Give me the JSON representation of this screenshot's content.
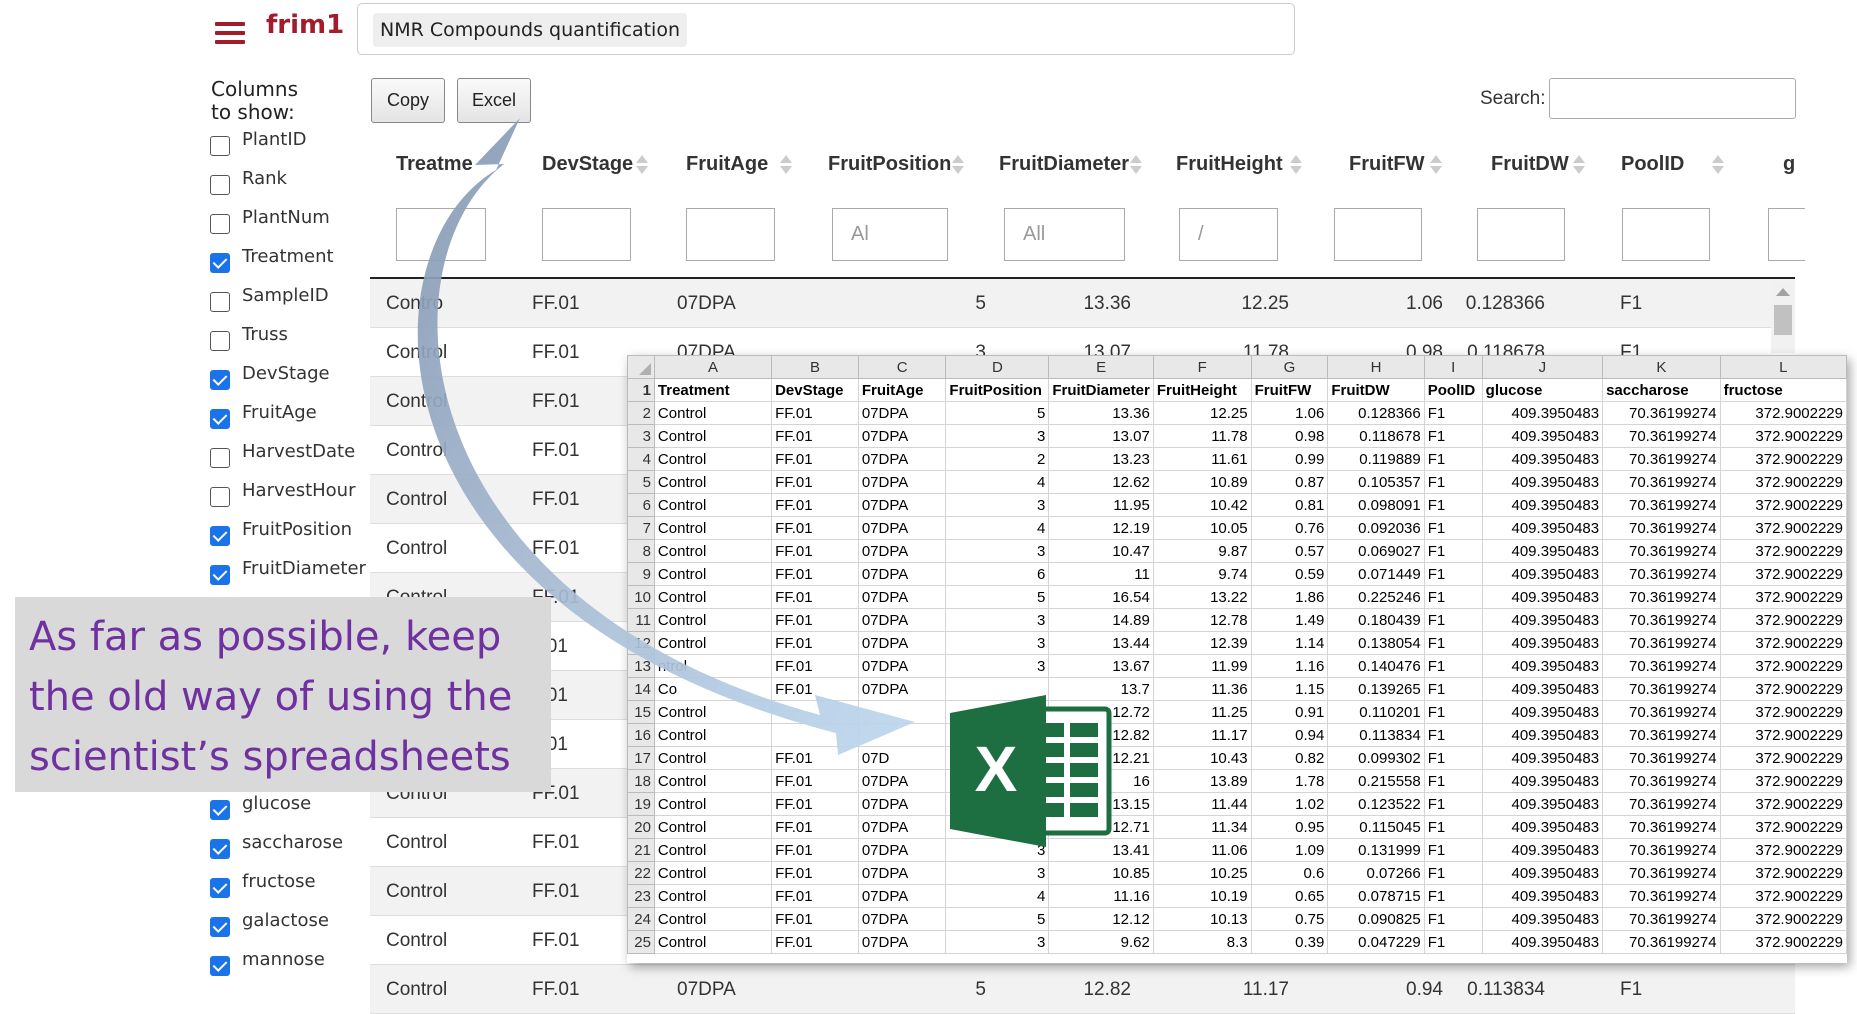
{
  "app": {
    "brand": "frim1",
    "title": "NMR Compounds quantification"
  },
  "sidebar": {
    "heading": "Columns to show:",
    "items": [
      {
        "label": "PlantID",
        "checked": false
      },
      {
        "label": "Rank",
        "checked": false
      },
      {
        "label": "PlantNum",
        "checked": false
      },
      {
        "label": "Treatment",
        "checked": true
      },
      {
        "label": "SampleID",
        "checked": false
      },
      {
        "label": "Truss",
        "checked": false
      },
      {
        "label": "DevStage",
        "checked": true
      },
      {
        "label": "FruitAge",
        "checked": true
      },
      {
        "label": "HarvestDate",
        "checked": false
      },
      {
        "label": "HarvestHour",
        "checked": false
      },
      {
        "label": "FruitPosition",
        "checked": true
      },
      {
        "label": "FruitDiameter",
        "checked": true
      },
      {
        "label": "glucose",
        "checked": true
      },
      {
        "label": "saccharose",
        "checked": true
      },
      {
        "label": "fructose",
        "checked": true
      },
      {
        "label": "galactose",
        "checked": true
      },
      {
        "label": "mannose",
        "checked": true
      }
    ]
  },
  "toolbar": {
    "copy_label": "Copy",
    "excel_label": "Excel",
    "search_label": "Search:",
    "search_value": ""
  },
  "table": {
    "headers": [
      "Treatme",
      "DevStage",
      "FruitAge",
      "FruitPosition",
      "FruitDiameter",
      "FruitHeight",
      "FruitFW",
      "FruitDW",
      "PoolID",
      "g"
    ],
    "filters": [
      "",
      "",
      "",
      "Al",
      "All",
      "/",
      "",
      "",
      "",
      ""
    ],
    "rows": [
      [
        "Contro",
        "FF.01",
        "07DPA",
        "5",
        "13.36",
        "12.25",
        "1.06",
        "0.128366",
        "F1"
      ],
      [
        "Control",
        "FF.01",
        "07DPA",
        "3",
        "13.07",
        "11.78",
        "0.98",
        "0.118678",
        "F1"
      ],
      [
        "Control",
        "FF.01",
        "",
        "",
        "",
        "",
        "",
        "",
        ""
      ],
      [
        "Control",
        "FF.01",
        "",
        "",
        "",
        "",
        "",
        "",
        ""
      ],
      [
        "Control",
        "FF.01",
        "",
        "",
        "",
        "",
        "",
        "",
        ""
      ],
      [
        "Control",
        "FF.01",
        "",
        "",
        "",
        "",
        "",
        "",
        ""
      ],
      [
        "Control",
        "FF.01",
        "",
        "",
        "",
        "",
        "",
        "",
        ""
      ],
      [
        "",
        "F.01",
        "",
        "",
        "",
        "",
        "",
        "",
        ""
      ],
      [
        "",
        "F.01",
        "",
        "",
        "",
        "",
        "",
        "",
        ""
      ],
      [
        "",
        "F.01",
        "",
        "",
        "",
        "",
        "",
        "",
        ""
      ],
      [
        "Control",
        "FF.01",
        "",
        "",
        "",
        "",
        "",
        "",
        ""
      ],
      [
        "Control",
        "FF.01",
        "",
        "",
        "",
        "",
        "",
        "",
        ""
      ],
      [
        "Control",
        "FF.01",
        "",
        "",
        "",
        "",
        "",
        "",
        ""
      ],
      [
        "Control",
        "FF.01",
        "",
        "",
        "",
        "",
        "",
        "",
        ""
      ],
      [
        "Control",
        "FF.01",
        "07DPA",
        "5",
        "12.82",
        "11.17",
        "0.94",
        "0.113834",
        "F1"
      ]
    ]
  },
  "spreadsheet": {
    "col_letters": [
      "A",
      "B",
      "C",
      "D",
      "E",
      "F",
      "G",
      "H",
      "I",
      "J",
      "K",
      "L"
    ],
    "headers": [
      "Treatment",
      "DevStage",
      "FruitAge",
      "FruitPosition",
      "FruitDiameter",
      "FruitHeight",
      "FruitFW",
      "FruitDW",
      "PoolID",
      "glucose",
      "saccharose",
      "fructose"
    ],
    "rows": [
      [
        "Control",
        "FF.01",
        "07DPA",
        "5",
        "13.36",
        "12.25",
        "1.06",
        "0.128366",
        "F1",
        "409.3950483",
        "70.36199274",
        "372.9002229"
      ],
      [
        "Control",
        "FF.01",
        "07DPA",
        "3",
        "13.07",
        "11.78",
        "0.98",
        "0.118678",
        "F1",
        "409.3950483",
        "70.36199274",
        "372.9002229"
      ],
      [
        "Control",
        "FF.01",
        "07DPA",
        "2",
        "13.23",
        "11.61",
        "0.99",
        "0.119889",
        "F1",
        "409.3950483",
        "70.36199274",
        "372.9002229"
      ],
      [
        "Control",
        "FF.01",
        "07DPA",
        "4",
        "12.62",
        "10.89",
        "0.87",
        "0.105357",
        "F1",
        "409.3950483",
        "70.36199274",
        "372.9002229"
      ],
      [
        "Control",
        "FF.01",
        "07DPA",
        "3",
        "11.95",
        "10.42",
        "0.81",
        "0.098091",
        "F1",
        "409.3950483",
        "70.36199274",
        "372.9002229"
      ],
      [
        "Control",
        "FF.01",
        "07DPA",
        "4",
        "12.19",
        "10.05",
        "0.76",
        "0.092036",
        "F1",
        "409.3950483",
        "70.36199274",
        "372.9002229"
      ],
      [
        "Control",
        "FF.01",
        "07DPA",
        "3",
        "10.47",
        "9.87",
        "0.57",
        "0.069027",
        "F1",
        "409.3950483",
        "70.36199274",
        "372.9002229"
      ],
      [
        "Control",
        "FF.01",
        "07DPA",
        "6",
        "11",
        "9.74",
        "0.59",
        "0.071449",
        "F1",
        "409.3950483",
        "70.36199274",
        "372.9002229"
      ],
      [
        "Control",
        "FF.01",
        "07DPA",
        "5",
        "16.54",
        "13.22",
        "1.86",
        "0.225246",
        "F1",
        "409.3950483",
        "70.36199274",
        "372.9002229"
      ],
      [
        "Control",
        "FF.01",
        "07DPA",
        "3",
        "14.89",
        "12.78",
        "1.49",
        "0.180439",
        "F1",
        "409.3950483",
        "70.36199274",
        "372.9002229"
      ],
      [
        "Control",
        "FF.01",
        "07DPA",
        "3",
        "13.44",
        "12.39",
        "1.14",
        "0.138054",
        "F1",
        "409.3950483",
        "70.36199274",
        "372.9002229"
      ],
      [
        "ntrol",
        "FF.01",
        "07DPA",
        "3",
        "13.67",
        "11.99",
        "1.16",
        "0.140476",
        "F1",
        "409.3950483",
        "70.36199274",
        "372.9002229"
      ],
      [
        "Co",
        "FF.01",
        "07DPA",
        "",
        "13.7",
        "11.36",
        "1.15",
        "0.139265",
        "F1",
        "409.3950483",
        "70.36199274",
        "372.9002229"
      ],
      [
        "Control",
        "",
        "",
        "",
        "12.72",
        "11.25",
        "0.91",
        "0.110201",
        "F1",
        "409.3950483",
        "70.36199274",
        "372.9002229"
      ],
      [
        "Control",
        "",
        "",
        "",
        "12.82",
        "11.17",
        "0.94",
        "0.113834",
        "F1",
        "409.3950483",
        "70.36199274",
        "372.9002229"
      ],
      [
        "Control",
        "FF.01",
        "07D",
        "",
        "12.21",
        "10.43",
        "0.82",
        "0.099302",
        "F1",
        "409.3950483",
        "70.36199274",
        "372.9002229"
      ],
      [
        "Control",
        "FF.01",
        "07DPA",
        "",
        "16",
        "13.89",
        "1.78",
        "0.215558",
        "F1",
        "409.3950483",
        "70.36199274",
        "372.9002229"
      ],
      [
        "Control",
        "FF.01",
        "07DPA",
        "",
        "13.15",
        "11.44",
        "1.02",
        "0.123522",
        "F1",
        "409.3950483",
        "70.36199274",
        "372.9002229"
      ],
      [
        "Control",
        "FF.01",
        "07DPA",
        "",
        "12.71",
        "11.34",
        "0.95",
        "0.115045",
        "F1",
        "409.3950483",
        "70.36199274",
        "372.9002229"
      ],
      [
        "Control",
        "FF.01",
        "07DPA",
        "3",
        "13.41",
        "11.06",
        "1.09",
        "0.131999",
        "F1",
        "409.3950483",
        "70.36199274",
        "372.9002229"
      ],
      [
        "Control",
        "FF.01",
        "07DPA",
        "3",
        "10.85",
        "10.25",
        "0.6",
        "0.07266",
        "F1",
        "409.3950483",
        "70.36199274",
        "372.9002229"
      ],
      [
        "Control",
        "FF.01",
        "07DPA",
        "4",
        "11.16",
        "10.19",
        "0.65",
        "0.078715",
        "F1",
        "409.3950483",
        "70.36199274",
        "372.9002229"
      ],
      [
        "Control",
        "FF.01",
        "07DPA",
        "5",
        "12.12",
        "10.13",
        "0.75",
        "0.090825",
        "F1",
        "409.3950483",
        "70.36199274",
        "372.9002229"
      ],
      [
        "Control",
        "FF.01",
        "07DPA",
        "3",
        "9.62",
        "8.3",
        "0.39",
        "0.047229",
        "F1",
        "409.3950483",
        "70.36199274",
        "372.9002229"
      ]
    ]
  },
  "callout": {
    "text": "As far as possible, keep the old way of using the scientist’s spreadsheets",
    "color": "#7030a0"
  },
  "excel_logo": {
    "icon": "excel-icon",
    "letter": "X",
    "color": "#1d6f42"
  }
}
